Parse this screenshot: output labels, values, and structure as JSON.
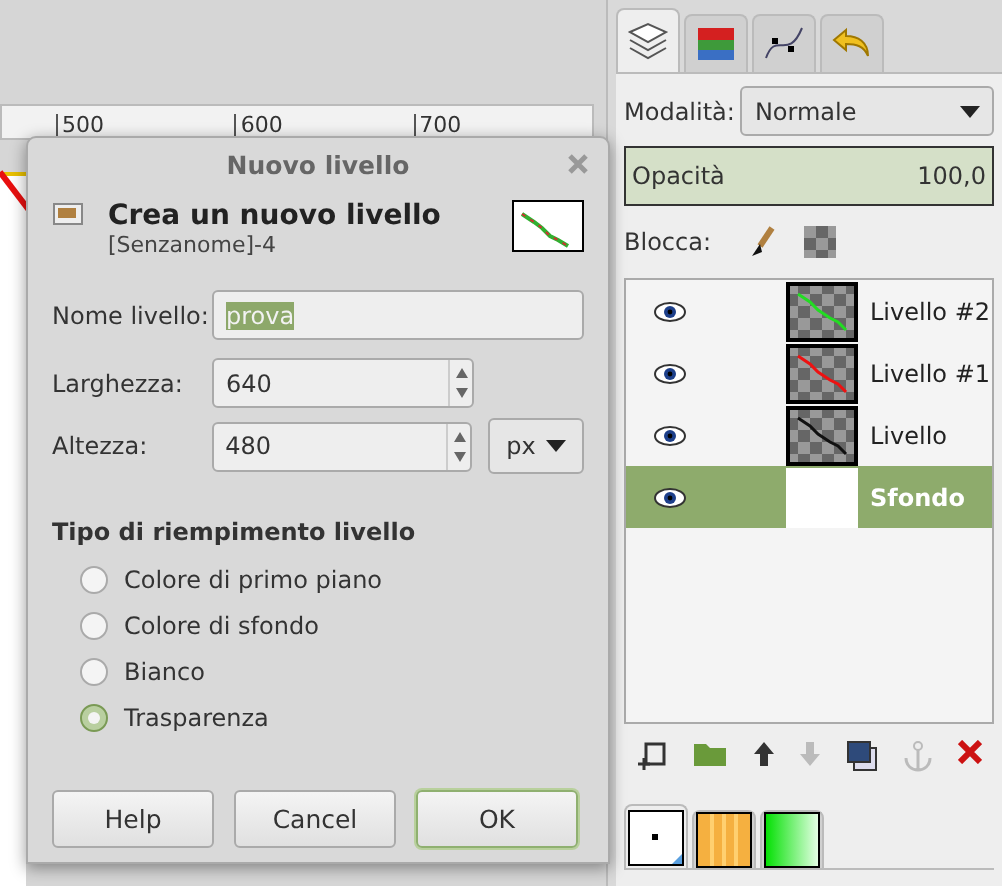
{
  "ruler": {
    "labels": [
      "500",
      "600",
      "700"
    ]
  },
  "dialog": {
    "title": "Nuovo livello",
    "heading": "Crea un nuovo livello",
    "subtitle": "[Senzanome]-4",
    "name_field": {
      "label": "Nome livello:",
      "value": "prova"
    },
    "width_field": {
      "label": "Larghezza:",
      "value": "640"
    },
    "height_field": {
      "label": "Altezza:",
      "value": "480",
      "unit": "px"
    },
    "fill_title": "Tipo di riempimento livello",
    "fill_options": [
      {
        "label": "Colore di primo piano",
        "selected": false
      },
      {
        "label": "Colore di sfondo",
        "selected": false
      },
      {
        "label": "Bianco",
        "selected": false
      },
      {
        "label": "Trasparenza",
        "selected": true
      }
    ],
    "buttons": [
      {
        "label": "Help",
        "default": false
      },
      {
        "label": "Cancel",
        "default": false
      },
      {
        "label": "OK",
        "default": true
      }
    ]
  },
  "layers_panel": {
    "tabs": [
      {
        "kind": "layers",
        "selected": true
      },
      {
        "kind": "channels",
        "selected": false
      },
      {
        "kind": "paths",
        "selected": false
      },
      {
        "kind": "undo",
        "selected": false
      }
    ],
    "mode": {
      "label": "Modalità:",
      "value": "Normale"
    },
    "opacity": {
      "label": "Opacità",
      "value": "100,0",
      "level": 1
    },
    "lock_label": "Blocca:",
    "layers": [
      {
        "name": "Livello #2",
        "visible": true,
        "selected": false,
        "color": "#22dd22"
      },
      {
        "name": "Livello #1",
        "visible": true,
        "selected": false,
        "color": "#ee1111"
      },
      {
        "name": "Livello",
        "visible": true,
        "selected": false,
        "color": "#111111"
      },
      {
        "name": "Sfondo",
        "visible": true,
        "selected": true
      }
    ],
    "toolbar": [
      {
        "kind": "new",
        "disabled": false
      },
      {
        "kind": "group",
        "disabled": false
      },
      {
        "kind": "raise",
        "disabled": false
      },
      {
        "kind": "lower",
        "disabled": true
      },
      {
        "kind": "duplicate",
        "disabled": false
      },
      {
        "kind": "anchor",
        "disabled": true
      },
      {
        "kind": "delete",
        "disabled": false
      }
    ],
    "bottom_tabs": [
      {
        "kind": "brush",
        "selected": true
      },
      {
        "kind": "pattern",
        "selected": false
      },
      {
        "kind": "gradient",
        "selected": false
      }
    ]
  }
}
